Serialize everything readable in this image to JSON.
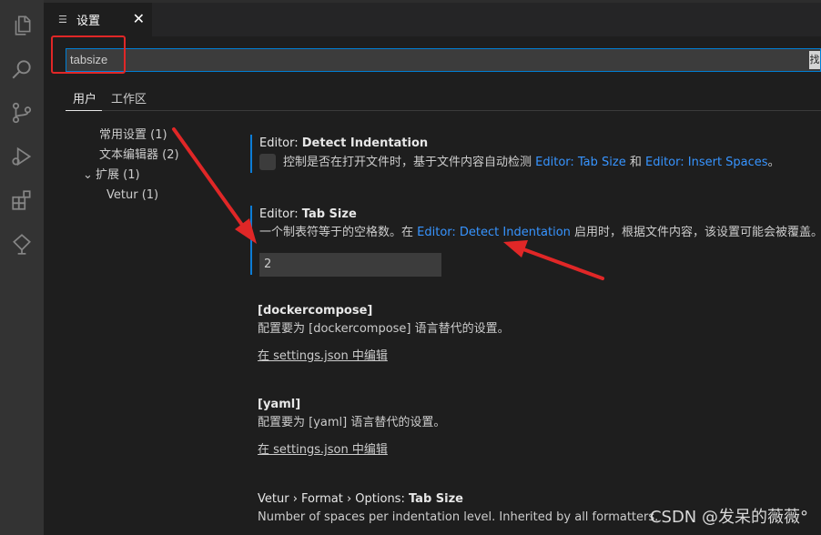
{
  "tab": {
    "label": "设置",
    "close": "✕"
  },
  "search": {
    "value": "tabsize",
    "suffix": "找"
  },
  "scope_tabs": {
    "user": "用户",
    "workspace": "工作区"
  },
  "toc": {
    "common": "常用设置 (1)",
    "text_editor": "文本编辑器 (2)",
    "extensions": "扩展 (1)",
    "vetur": "Vetur (1)"
  },
  "settings": {
    "detect": {
      "category": "Editor: ",
      "name": "Detect Indentation",
      "desc_prefix": "控制是否在打开文件时，基于文件内容自动检测 ",
      "link1": "Editor: Tab Size",
      "desc_mid": " 和 ",
      "link2": "Editor: Insert Spaces",
      "desc_suffix": "。"
    },
    "tab_size": {
      "category": "Editor: ",
      "name": "Tab Size",
      "desc_prefix": "一个制表符等于的空格数。在 ",
      "link": "Editor: Detect Indentation",
      "desc_suffix": " 启用时，根据文件内容，该设置可能会被覆盖。",
      "value": "2"
    },
    "dockercompose": {
      "name": "[dockercompose]",
      "desc": "配置要为 [dockercompose] 语言替代的设置。",
      "edit": "在 settings.json 中编辑"
    },
    "yaml": {
      "name": "[yaml]",
      "desc": "配置要为 [yaml] 语言替代的设置。",
      "edit": "在 settings.json 中编辑"
    },
    "vetur": {
      "category": "Vetur › Format › Options: ",
      "name": "Tab Size",
      "desc": "Number of spaces per indentation level. Inherited by all formatters."
    }
  },
  "watermark": "CSDN @发呆的薇薇°",
  "colors": {
    "accent": "#007fd4",
    "link": "#3794ff",
    "annotation": "#e02727",
    "modified_bar": "#0c7dd7"
  }
}
